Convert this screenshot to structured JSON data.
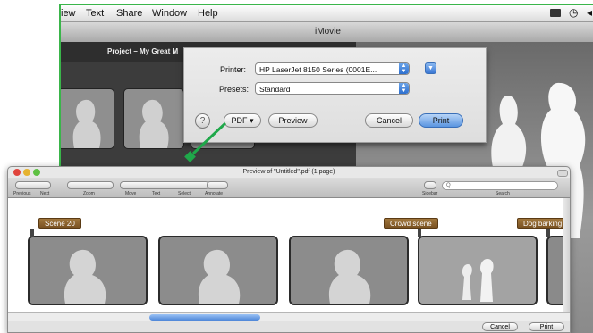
{
  "menubar": {
    "items": [
      "iew",
      "Text",
      "Share",
      "Window",
      "Help"
    ]
  },
  "imovie_window": {
    "title": "iMovie",
    "project_header": "Project – My Great M"
  },
  "print_sheet": {
    "printer_label": "Printer:",
    "printer_value": "HP LaserJet 8150 Series (0001E...",
    "presets_label": "Presets:",
    "presets_value": "Standard",
    "help_label": "?",
    "pdf_button": "PDF ▾",
    "preview_button": "Preview",
    "cancel_button": "Cancel",
    "print_button": "Print"
  },
  "preview_window": {
    "title": "Preview of \"Untitled\".pdf (1 page)",
    "toolbar": {
      "previous": "Previous",
      "next": "Next",
      "zoom": "Zoom",
      "move": "Move",
      "text": "Text",
      "select": "Select",
      "annotate": "Annotate",
      "sidebar": "Sidebar",
      "search": "Search",
      "search_glyph": "Q"
    },
    "tags": [
      "Scene 20",
      "Crowd scene",
      "Dog barking"
    ],
    "footer": {
      "cancel": "Cancel",
      "print": "Print"
    }
  },
  "colors": {
    "arrow_green": "#1fa84a",
    "tag_brown": "#8a5f2c",
    "default_button_blue": "#5a95e0"
  }
}
